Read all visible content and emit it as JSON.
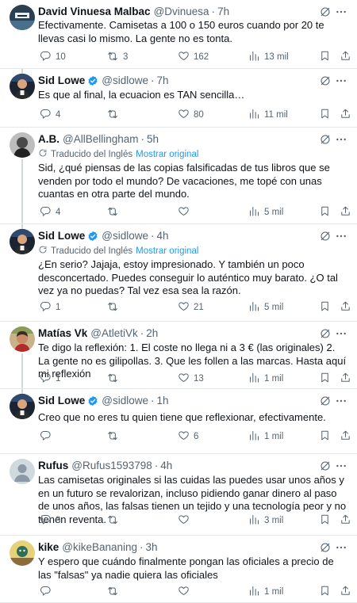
{
  "translation": {
    "label": "Traducido del Inglés",
    "show_original": "Mostrar original"
  },
  "icons": {
    "reply": "reply-icon",
    "retweet": "retweet-icon",
    "like": "heart-icon",
    "views": "views-icon",
    "bookmark": "bookmark-icon",
    "share": "share-icon",
    "grok": "grok-icon",
    "more": "more-icon",
    "verified": "verified-badge-icon"
  },
  "colors": {
    "text": "#0f1419",
    "secondary": "#536471",
    "link": "#1d9bf0",
    "verified": "#1d9bf0",
    "divider": "#e4e8eb",
    "thread_line": "#cfd9de"
  },
  "tweets": [
    {
      "name": "David Vinuesa Malbac",
      "handle": "@Dvinuesa",
      "time": "7h",
      "text": "Efectivamente. Camisetas a 100 o 150 euros cuando por 20 te llevas casi lo mismo. La gente no es tonta.",
      "replies": "10",
      "retweets": "3",
      "likes": "162",
      "views": "13 mil"
    },
    {
      "name": "Sid Lowe",
      "handle": "@sidlowe",
      "time": "7h",
      "verified": true,
      "text": "Es que al final, la ecuacion es TAN sencilla…",
      "replies": "4",
      "retweets": "",
      "likes": "80",
      "views": "11 mil"
    },
    {
      "name": "A.B.",
      "handle": "@AllBellingham",
      "time": "5h",
      "translated": true,
      "text": "Sid, ¿qué piensas de las copias falsificadas de tus libros que se venden por todo el mundo? De vacaciones, me topé con unas cuantas en otra parte del mundo.",
      "replies": "4",
      "retweets": "",
      "likes": "",
      "views": "5 mil"
    },
    {
      "name": "Sid Lowe",
      "handle": "@sidlowe",
      "time": "4h",
      "verified": true,
      "translated": true,
      "text": "¿En serio? Jajaja, estoy impresionado. Y también un poco desconcertado. Puedes conseguir lo auténtico muy barato. ¿O tal vez ya no puedas? Tal vez esa sea la razón.",
      "replies": "1",
      "retweets": "",
      "likes": "21",
      "views": "5 mil"
    },
    {
      "name": "Matías Vk",
      "handle": "@AtletiVk",
      "time": "2h",
      "text": "Te digo la reflexión: 1. El coste no llega ni a 3 € (las originales) 2. La gente no es gilipollas. 3. Que les follen a las marcas. Hasta aquí mi reflexión",
      "replies": "1",
      "retweets": "",
      "likes": "13",
      "views": "1 mil"
    },
    {
      "name": "Sid Lowe",
      "handle": "@sidlowe",
      "time": "1h",
      "verified": true,
      "text": "Creo que no eres tu quien tiene que reflexionar, efectivamente.",
      "replies": "",
      "retweets": "",
      "likes": "6",
      "views": "1 mil"
    },
    {
      "name": "Rufus",
      "handle": "@Rufus1593798",
      "time": "4h",
      "text": "Las camisetas originales si las cuidas las puedes usar unos años y en un futuro se revalorizan, incluso pidiendo ganar dinero al paso de unos años, las falsas tienen un tejido y una tecnología peor y no tienen reventa.",
      "replies": "3",
      "retweets": "",
      "likes": "",
      "views": "3 mil"
    },
    {
      "name": "kike",
      "handle": "@kikeBananing",
      "time": "3h",
      "text": "Y espero que cuándo finalmente pongan las oficiales a precio de las \"falsas\" ya nadie quiera las oficiales",
      "replies": "",
      "retweets": "",
      "likes": "",
      "views": "1 mil"
    }
  ]
}
